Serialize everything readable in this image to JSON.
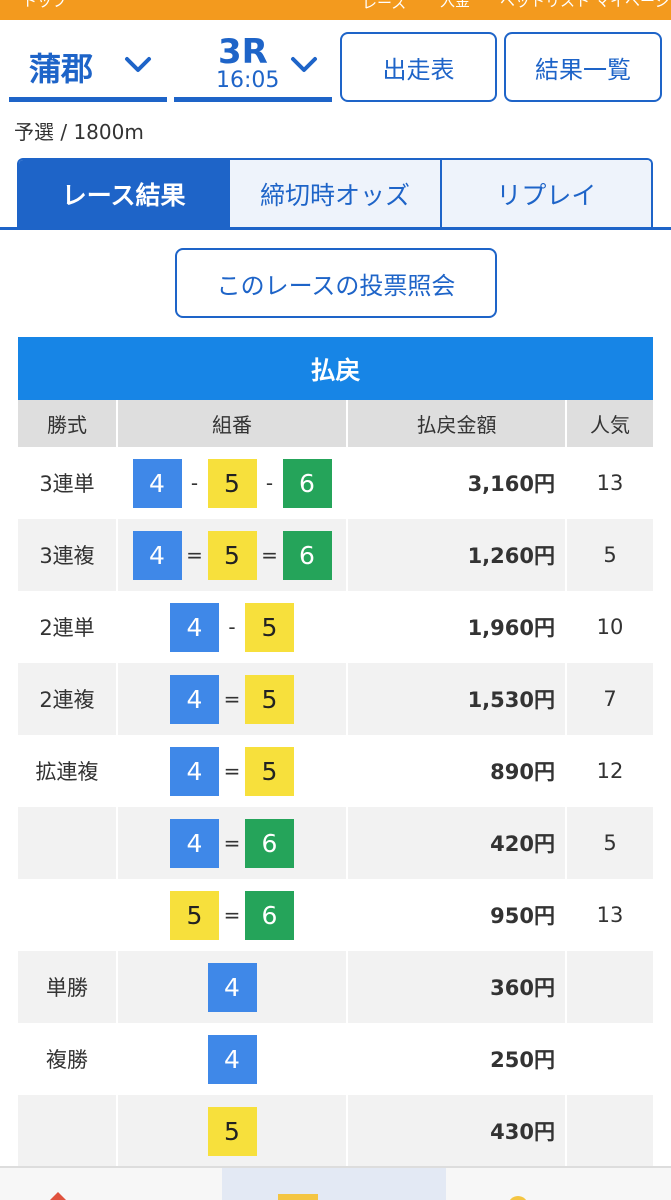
{
  "topnav": [
    "トップ",
    "レース",
    "入金",
    "ベットリスト",
    "マイページ"
  ],
  "venue": {
    "name": "蒲郡"
  },
  "race": {
    "number": "3R",
    "time": "16:05"
  },
  "header_buttons": {
    "entry": "出走表",
    "results": "結果一覧"
  },
  "race_info": "予選 / 1800m",
  "tabs": [
    {
      "label": "レース結果",
      "active": true
    },
    {
      "label": "締切時オッズ",
      "active": false
    },
    {
      "label": "リプレイ",
      "active": false
    }
  ],
  "vote_button": "このレースの投票照会",
  "payout": {
    "title": "払戻",
    "headers": [
      "勝式",
      "組番",
      "払戻金額",
      "人気"
    ],
    "rows": [
      {
        "type": "3連単",
        "boats": [
          "4",
          "5",
          "6"
        ],
        "sep": "-",
        "amount": "3,160円",
        "pop": "13"
      },
      {
        "type": "3連複",
        "boats": [
          "4",
          "5",
          "6"
        ],
        "sep": "=",
        "amount": "1,260円",
        "pop": "5"
      },
      {
        "type": "2連単",
        "boats": [
          "4",
          "5"
        ],
        "sep": "-",
        "amount": "1,960円",
        "pop": "10"
      },
      {
        "type": "2連複",
        "boats": [
          "4",
          "5"
        ],
        "sep": "=",
        "amount": "1,530円",
        "pop": "7"
      },
      {
        "type": "拡連複",
        "boats": [
          "4",
          "5"
        ],
        "sep": "=",
        "amount": "890円",
        "pop": "12"
      },
      {
        "type": "",
        "boats": [
          "4",
          "6"
        ],
        "sep": "=",
        "amount": "420円",
        "pop": "5"
      },
      {
        "type": "",
        "boats": [
          "5",
          "6"
        ],
        "sep": "=",
        "amount": "950円",
        "pop": "13"
      },
      {
        "type": "単勝",
        "boats": [
          "4"
        ],
        "sep": "",
        "amount": "360円",
        "pop": ""
      },
      {
        "type": "複勝",
        "boats": [
          "4"
        ],
        "sep": "",
        "amount": "250円",
        "pop": ""
      },
      {
        "type": "",
        "boats": [
          "5"
        ],
        "sep": "",
        "amount": "430円",
        "pop": ""
      }
    ]
  },
  "boat_colors": {
    "1": {
      "bg": "#ffffff",
      "fg": "#222222"
    },
    "2": {
      "bg": "#222222",
      "fg": "#ffffff"
    },
    "3": {
      "bg": "#e53935",
      "fg": "#ffffff"
    },
    "4": {
      "bg": "#3f88e8",
      "fg": "#ffffff"
    },
    "5": {
      "bg": "#f7e03c",
      "fg": "#222222"
    },
    "6": {
      "bg": "#25a45a",
      "fg": "#ffffff"
    }
  },
  "colors": {
    "brand": "#1e64c8",
    "orange": "#f39a1e",
    "table_header": "#1785e6"
  }
}
